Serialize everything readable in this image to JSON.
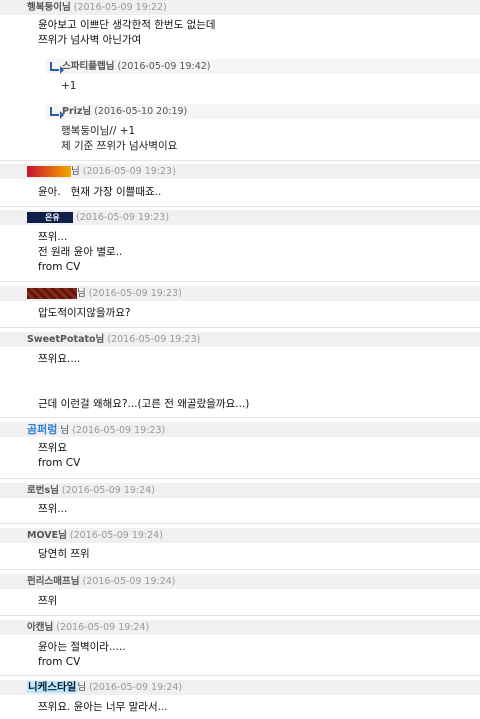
{
  "comments": [
    {
      "author": "행복둥이님",
      "time": "(2016-05-09 19:22)",
      "lines": [
        "윤아보고 이쁘단 생각한적 한번도 없는데",
        "쯔위가 넘사벽 아닌가여"
      ]
    },
    {
      "author": "스파티플렙님",
      "time": "(2016-05-09 19:42)",
      "lines": [
        "+1"
      ]
    },
    {
      "author": "Priz님",
      "time": "(2016-05-10 20:19)",
      "lines": [
        "행복둥이님// +1",
        "제 기준 쯔위가 넘사벽이요"
      ]
    },
    {
      "author_suffix": "님",
      "time": "(2016-05-09 19:23)",
      "lines": [
        "윤아.   현재 가장 이쁠때죠.."
      ]
    },
    {
      "badge": "은유",
      "time": "(2016-05-09 19:23)",
      "lines": [
        "쯔위...",
        "전 원래 윤아 별로..",
        "from CV"
      ]
    },
    {
      "author_suffix": "님",
      "time": "(2016-05-09 19:23)",
      "lines": [
        "압도적이지않을까요?"
      ]
    },
    {
      "author": "SweetPotato님",
      "time": "(2016-05-09 19:23)",
      "lines": [
        "쯔위요....",
        "",
        "",
        "근데 이런걸 왜해요?...(고른 전 왜골랐을까요...)"
      ]
    },
    {
      "author": "곰퍼렁",
      "author_suffix": "님",
      "time": "(2016-05-09 19:23)",
      "lines": [
        "쯔위요",
        "from CV"
      ]
    },
    {
      "author": "로번s님",
      "time": "(2016-05-09 19:24)",
      "lines": [
        "쯔위..."
      ]
    },
    {
      "author": "MOVE님",
      "time": "(2016-05-09 19:24)",
      "lines": [
        "당연히 쯔위"
      ]
    },
    {
      "author": "펀리스매프님",
      "time": "(2016-05-09 19:24)",
      "lines": [
        "쯔위"
      ]
    },
    {
      "author": "아캔님",
      "time": "(2016-05-09 19:24)",
      "lines": [
        "윤아는 절벽이라.....",
        "from CV"
      ]
    },
    {
      "author": "니케스타일",
      "author_suffix": "님",
      "time": "(2016-05-09 19:24)",
      "lines": [
        "쯔위요. 윤아는 너무 말라서..."
      ]
    }
  ],
  "colors": {
    "bar": "#f0f0f0",
    "reply_arrow": "#2c5fa8",
    "timestamp": "#999999"
  }
}
